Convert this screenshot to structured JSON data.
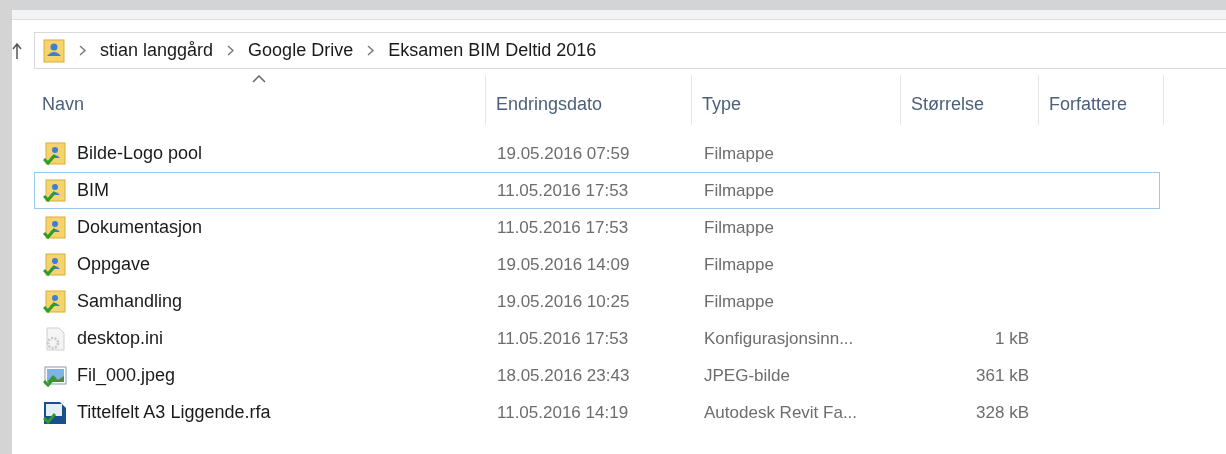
{
  "breadcrumb": [
    "stian langgård",
    "Google Drive",
    "Eksamen BIM Deltid 2016"
  ],
  "table": {
    "columns": [
      {
        "label": "Navn",
        "sorted": true
      },
      {
        "label": "Endringsdato",
        "sorted": false
      },
      {
        "label": "Type",
        "sorted": false
      },
      {
        "label": "Størrelse",
        "sorted": false
      },
      {
        "label": "Forfattere",
        "sorted": false
      }
    ],
    "rows": [
      {
        "kind": "folder",
        "name": "Bilde-Logo pool",
        "date": "19.05.2016 07:59",
        "type": "Filmappe",
        "selected": false
      },
      {
        "kind": "folder",
        "name": "BIM",
        "date": "11.05.2016 17:53",
        "type": "Filmappe",
        "selected": true
      },
      {
        "kind": "folder",
        "name": "Dokumentasjon",
        "date": "11.05.2016 17:53",
        "type": "Filmappe",
        "selected": false
      },
      {
        "kind": "folder",
        "name": "Oppgave",
        "date": "19.05.2016 14:09",
        "type": "Filmappe",
        "selected": false
      },
      {
        "kind": "folder",
        "name": "Samhandling",
        "date": "19.05.2016 10:25",
        "type": "Filmappe",
        "selected": false
      },
      {
        "kind": "settings",
        "name": "desktop.ini",
        "date": "11.05.2016 17:53",
        "type": "Konfigurasjonsinn...",
        "size": "1 kB",
        "selected": false
      },
      {
        "kind": "image",
        "name": "Fil_000.jpeg",
        "date": "18.05.2016 23:43",
        "type": "JPEG-bilde",
        "size": "361 kB",
        "selected": false
      },
      {
        "kind": "revit",
        "name": "Tittelfelt A3 Liggende.rfa",
        "date": "11.05.2016 14:19",
        "type": "Autodesk Revit Fa...",
        "size": "328 kB",
        "selected": false
      }
    ]
  }
}
